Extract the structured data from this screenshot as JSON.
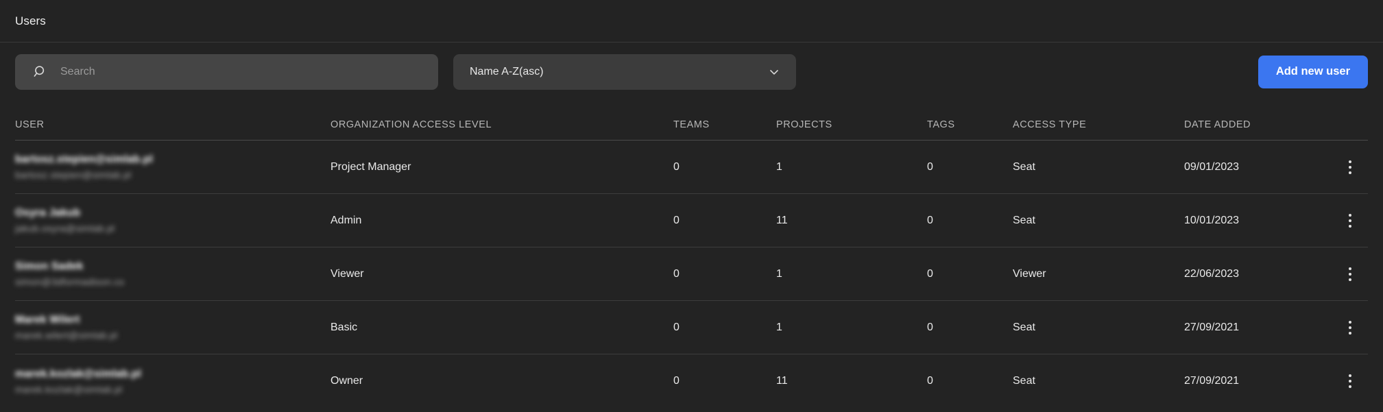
{
  "header": {
    "title": "Users"
  },
  "toolbar": {
    "search": {
      "placeholder": "Search",
      "value": "",
      "icon": "search-icon"
    },
    "sort": {
      "value": "Name A-Z(asc)",
      "icon": "chevron-down-icon"
    },
    "add_user_label": "Add new user",
    "accent_color": "#3b76f0"
  },
  "table": {
    "columns": [
      "USER",
      "ORGANIZATION ACCESS LEVEL",
      "TEAMS",
      "PROJECTS",
      "TAGS",
      "ACCESS TYPE",
      "DATE ADDED"
    ],
    "row_menu_icon": "kebab-menu-icon",
    "rows": [
      {
        "name": "bartosz.stepien@simlab.pl",
        "email": "bartosz.stepien@simlab.pl",
        "access_level": "Project Manager",
        "teams": "0",
        "projects": "1",
        "tags": "0",
        "access_type": "Seat",
        "date_added": "09/01/2023"
      },
      {
        "name": "Osyra Jakub",
        "email": "jakub.osyra@simlab.pl",
        "access_level": "Admin",
        "teams": "0",
        "projects": "11",
        "tags": "0",
        "access_type": "Seat",
        "date_added": "10/01/2023"
      },
      {
        "name": "Simon Sadek",
        "email": "simon@3dformadison.co",
        "access_level": "Viewer",
        "teams": "0",
        "projects": "1",
        "tags": "0",
        "access_type": "Viewer",
        "date_added": "22/06/2023"
      },
      {
        "name": "Marek Wilert",
        "email": "marek.wilert@simlab.pl",
        "access_level": "Basic",
        "teams": "0",
        "projects": "1",
        "tags": "0",
        "access_type": "Seat",
        "date_added": "27/09/2021"
      },
      {
        "name": "marek.kozlak@simlab.pl",
        "email": "marek.kozlak@simlab.pl",
        "access_level": "Owner",
        "teams": "0",
        "projects": "11",
        "tags": "0",
        "access_type": "Seat",
        "date_added": "27/09/2021"
      }
    ]
  }
}
